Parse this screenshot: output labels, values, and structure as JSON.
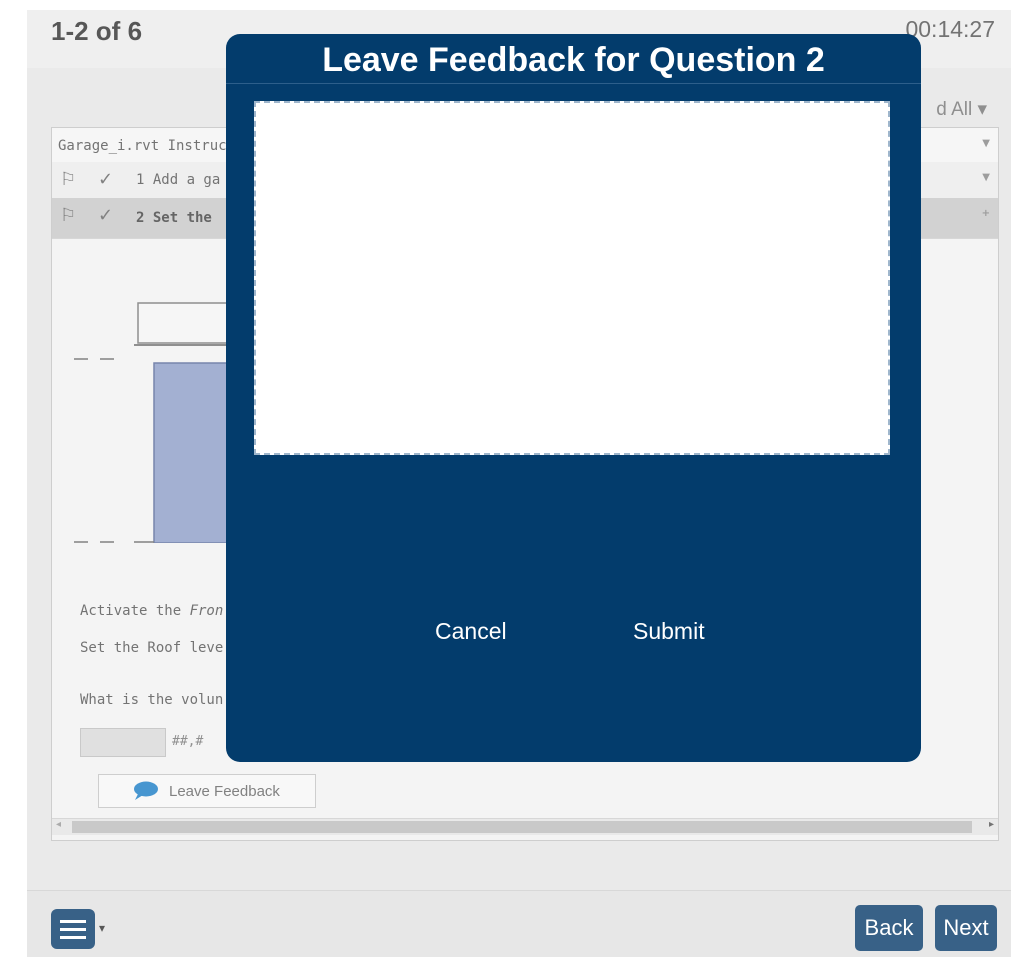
{
  "header": {
    "pager": "1-2 of 6",
    "timer": "00:14:27",
    "expand_all": "d All ▾"
  },
  "panel": {
    "file_row": "Garage_i.rvt Instruc",
    "question1": "1 Add a ga",
    "question2": "2 Set the",
    "instructions": {
      "activate_prefix": "Activate the ",
      "activate_italic": "Fron",
      "roof_line": "Set the Roof leve",
      "volume_line": "What is the volun"
    },
    "answer_format": "##,#",
    "leave_feedback": "Leave Feedback"
  },
  "footer": {
    "back": "Back",
    "next": "Next"
  },
  "modal": {
    "title": "Leave Feedback for Question 2",
    "feedback_value": "",
    "cancel": "Cancel",
    "submit": "Submit"
  },
  "icons": {
    "flag": "flag-icon",
    "check": "check-icon",
    "comment": "speech-bubble-icon",
    "menu": "hamburger-menu-icon"
  },
  "colors": {
    "modal_bg": "#033c6c",
    "nav_button": "#0d3f6d",
    "drawing_fill": "#8f9fc9"
  }
}
